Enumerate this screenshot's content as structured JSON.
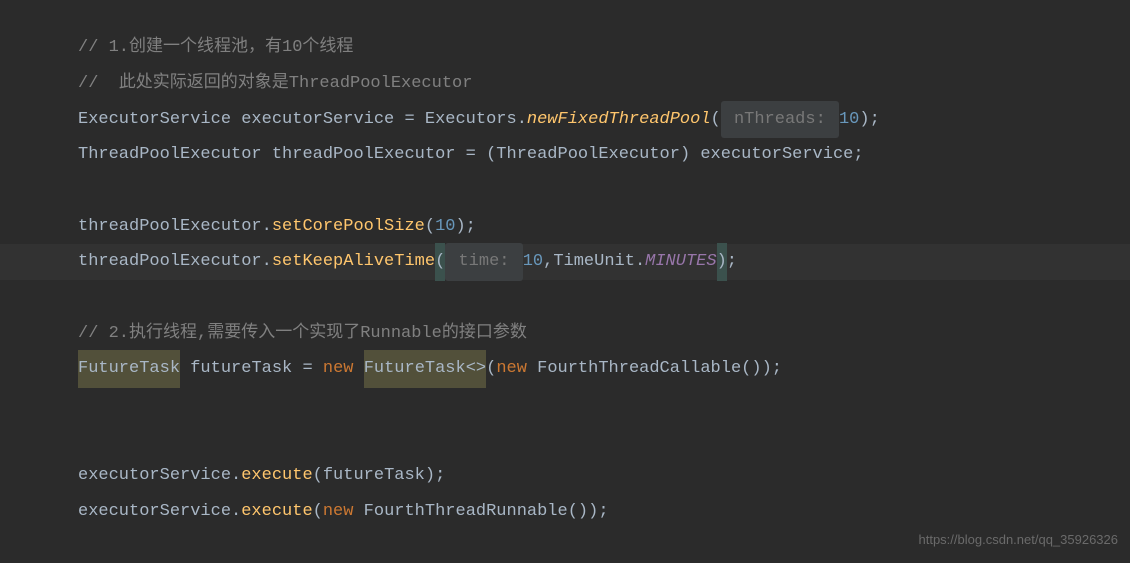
{
  "code": {
    "line1_comment": "// 1.创建一个线程池，有10个线程",
    "line2_comment": "//  此处实际返回的对象是ThreadPoolExecutor",
    "line3": {
      "type1": "ExecutorService",
      "var1": "executorService",
      "equals": " = ",
      "type2": "Executors",
      "dot": ".",
      "method": "newFixedThreadPool",
      "open": "(",
      "hint": " nThreads: ",
      "num": "10",
      "close": ");"
    },
    "line4": {
      "type1": "ThreadPoolExecutor",
      "var1": "threadPoolExecutor",
      "equals": " = (",
      "type2": "ThreadPoolExecutor",
      "close_cast": ") ",
      "var2": "executorService",
      "semi": ";"
    },
    "line6": {
      "var": "threadPoolExecutor",
      "dot": ".",
      "method": "setCorePoolSize",
      "open": "(",
      "num": "10",
      "close": ");"
    },
    "line7": {
      "var": "threadPoolExecutor",
      "dot": ".",
      "method": "setKeepAliveTime",
      "open": "(",
      "hint": " time: ",
      "num": "10",
      "comma": ",",
      "type": "TimeUnit",
      "dot2": ".",
      "constant": "MINUTES",
      "close": ")",
      "semi": ";"
    },
    "line9_comment": "// 2.执行线程,需要传入一个实现了Runnable的接口参数",
    "line10": {
      "type1": "FutureTask",
      "space1": " ",
      "var": "futureTask",
      "equals": " = ",
      "new1": "new",
      "space2": " ",
      "type2": "FutureTask<>",
      "open": "(",
      "new2": "new",
      "space3": " ",
      "type3": "FourthThreadCallable",
      "close": "());"
    },
    "line13": {
      "var": "executorService",
      "dot": ".",
      "method": "execute",
      "open": "(",
      "arg": "futureTask",
      "close": ");"
    },
    "line14": {
      "var": "executorService",
      "dot": ".",
      "method": "execute",
      "open": "(",
      "new": "new",
      "space": " ",
      "type": "FourthThreadRunnable",
      "close": "());"
    }
  },
  "watermark": "https://blog.csdn.net/qq_35926326"
}
